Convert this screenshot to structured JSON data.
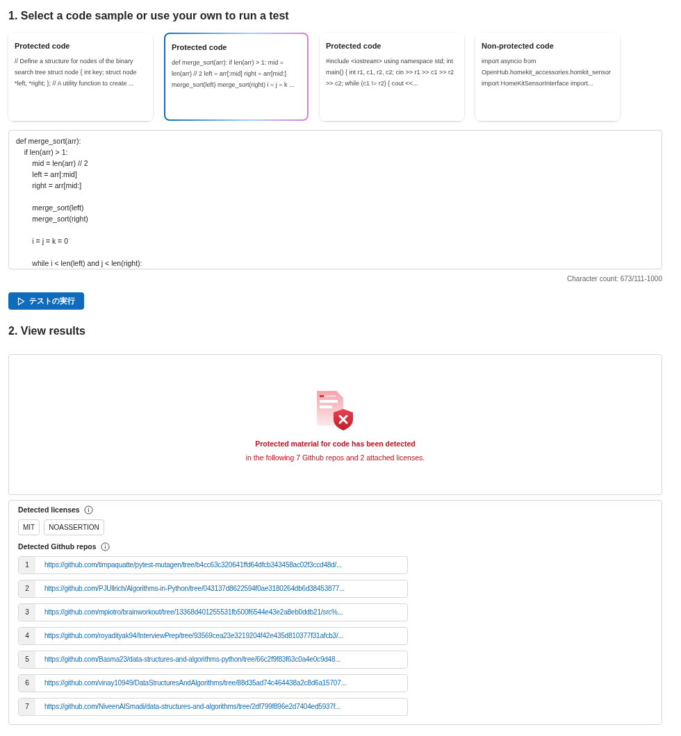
{
  "step1_heading": "1. Select a code sample or use your own to run a test",
  "samples": [
    {
      "title": "Protected code",
      "preview": "// Define a structure for nodes of the binary search tree struct node { int key; struct node *left, *right; }; // A utility function to create ...",
      "selected": false
    },
    {
      "title": "Protected code",
      "preview": "def merge_sort(arr): if len(arr) > 1: mid = len(arr) // 2 left = arr[:mid] right = arr[mid:] merge_sort(left) merge_sort(right) i = j = k ...",
      "selected": true
    },
    {
      "title": "Protected code",
      "preview": "#include <iostream> using namespace std; int main() { int r1, c1, r2, c2; cin >> r1 >> c1 >> r2 >> c2; while (c1 != r2) { cout <<...",
      "selected": false
    },
    {
      "title": "Non-protected code",
      "preview": "import asyncio from OpenHub.homekit_accessories.homkit_sensor import HomeKitSensorInterface import...",
      "selected": false
    }
  ],
  "code_blocks": [
    [
      "def merge_sort(arr):",
      "    if len(arr) > 1:",
      "        mid = len(arr) // 2",
      "        left = arr[:mid]",
      "        right = arr[mid:]"
    ],
    [
      "        merge_sort(left)",
      "        merge_sort(right)"
    ],
    [
      "        i = j = k = 0"
    ],
    [
      "        while i < len(left) and j < len(right):"
    ]
  ],
  "character_count": "Character count: 673/111-1000",
  "run_button": "テストの実行",
  "step2_heading": "2. View results",
  "result": {
    "title": "Protected material for code has been detected",
    "subtitle": "in the following 7 Github repos and 2 attached licenses."
  },
  "licenses": {
    "label": "Detected licenses",
    "items": [
      "MIT",
      "NOASSERTION"
    ]
  },
  "repos": {
    "label": "Detected Github repos",
    "items": [
      {
        "index": "1",
        "url": "https://github.com/timpaquatte/pytest-mutagen/tree/b4cc63c320641ffd64dfcb343458ac02f3ccd48d/..."
      },
      {
        "index": "2",
        "url": "https://github.com/PJUllrich/Algorithms-in-Python/tree/043137d8622594f0ae3180264db6d38453877..."
      },
      {
        "index": "3",
        "url": "https://github.com/mpiotro/brainworkout/tree/13368d401255531fb500f6544e43e2a8eb0ddb21/src%..."
      },
      {
        "index": "4",
        "url": "https://github.com/royadityak94/InterviewPrep/tree/93569cea23e3219204f42e435d810377f31afcb3/..."
      },
      {
        "index": "5",
        "url": "https://github.com/Basma23/data-structures-and-algorithms-python/tree/66c2f9f83f63c0a4e0c9d48..."
      },
      {
        "index": "6",
        "url": "https://github.com/vinay10949/DataStructuresAndAlgorithms/tree/88d35ad74c464438a2c8d6a15707..."
      },
      {
        "index": "7",
        "url": "https://github.com/NiveenAlSmadi/data-structures-and-algorithms/tree/2df799f896e2d7404ed5937f..."
      }
    ]
  }
}
